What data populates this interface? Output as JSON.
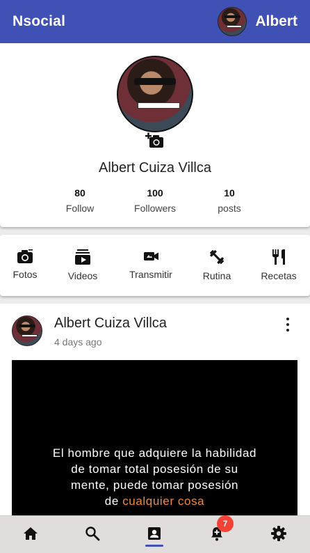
{
  "appbar": {
    "brand": "Nsocial",
    "user_name": "Albert"
  },
  "profile": {
    "name": "Albert Cuiza Villca",
    "stats": [
      {
        "value": "80",
        "label": "Follow"
      },
      {
        "value": "100",
        "label": "Followers"
      },
      {
        "value": "10",
        "label": "posts"
      }
    ]
  },
  "actions": [
    {
      "label": "Fotos",
      "icon": "camera-icon"
    },
    {
      "label": "Videos",
      "icon": "video-library-icon"
    },
    {
      "label": "Transmitir",
      "icon": "video-camera-icon"
    },
    {
      "label": "Rutina",
      "icon": "dumbbell-icon"
    },
    {
      "label": "Recetas",
      "icon": "restaurant-icon"
    }
  ],
  "post": {
    "author": "Albert Cuiza Villca",
    "time": "4 days ago",
    "quote_lines": [
      "El hombre que adquiere la habilidad",
      "de tomar total posesión de su",
      "mente, puede tomar posesión"
    ],
    "quote_last_prefix": "de ",
    "quote_highlight": "cualquier cosa"
  },
  "bottomnav": {
    "items": [
      "home-icon",
      "search-icon",
      "account-box-icon",
      "notification-add-icon",
      "settings-icon"
    ],
    "active": "account-box-icon",
    "notification_count": "7"
  },
  "colors": {
    "primary": "#3f51b5",
    "highlight": "#f0873a",
    "badge": "#f44336"
  }
}
